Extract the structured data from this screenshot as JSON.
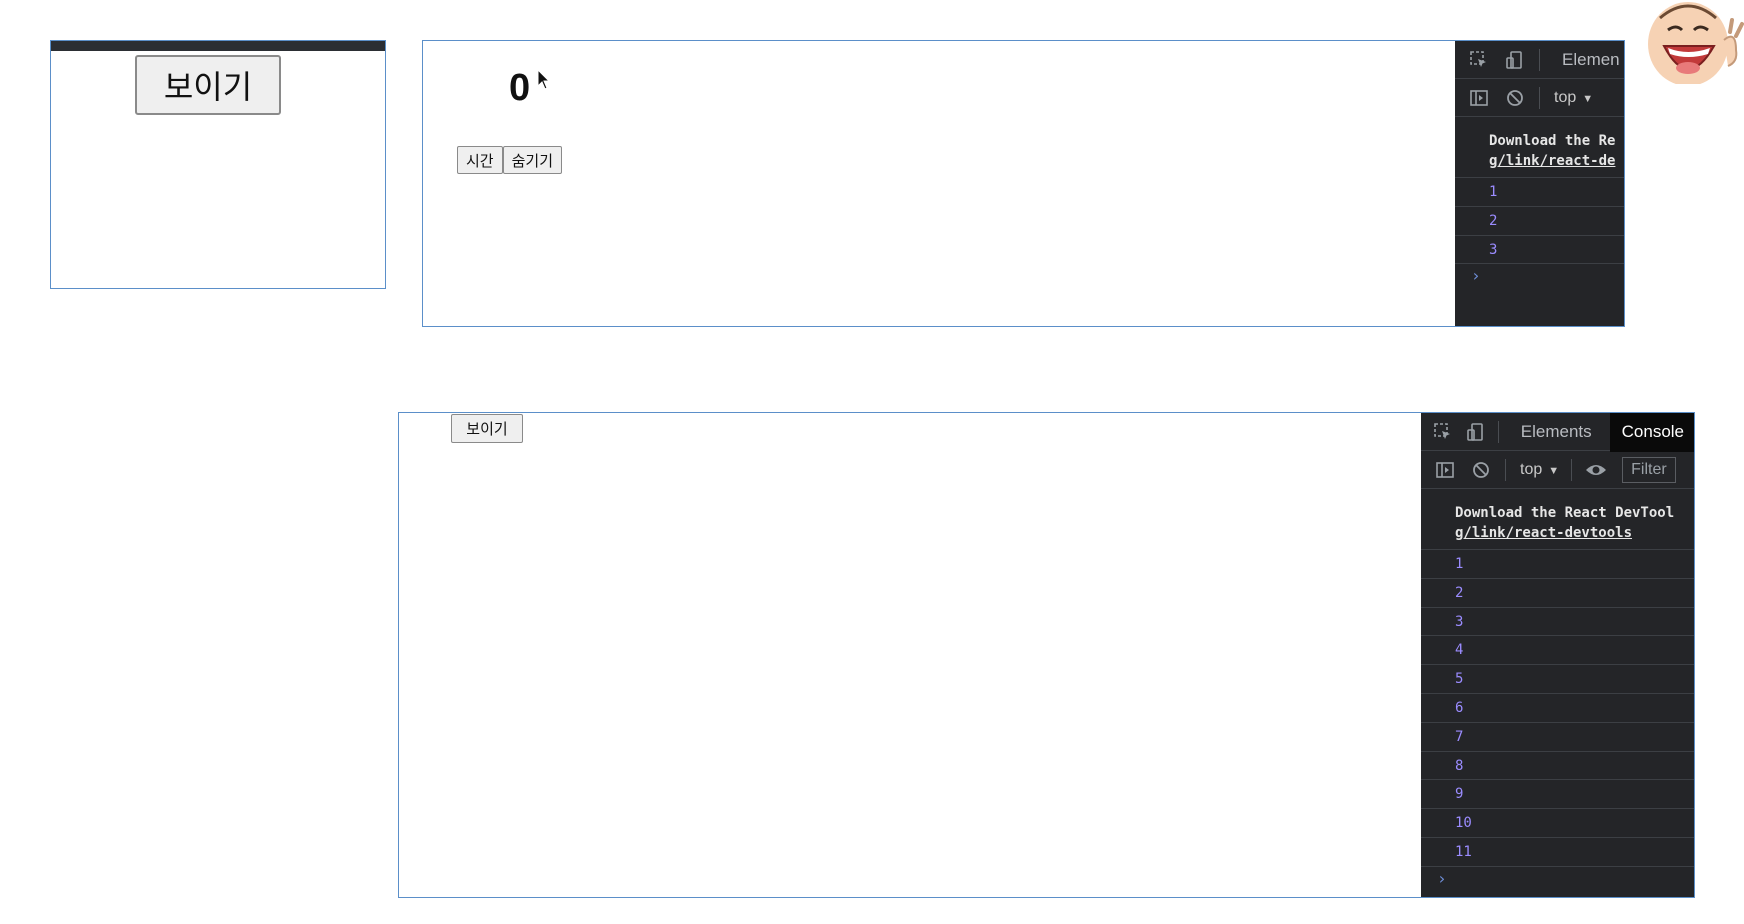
{
  "panel1": {
    "button_label": "보이기"
  },
  "panel2": {
    "counter": "0",
    "buttons": [
      "시간",
      "숨기기"
    ],
    "devtools": {
      "tabs": [
        "Elemen"
      ],
      "context": "top",
      "message_line1": "Download the Re",
      "message_link": "g/link/react-de",
      "logs": [
        "1",
        "2",
        "3"
      ],
      "prompt": "›"
    }
  },
  "panel3": {
    "button_label": "보이기",
    "devtools": {
      "tabs": [
        "Elements",
        "Console"
      ],
      "context": "top",
      "filter_placeholder": "Filter",
      "message_line1": "Download the React DevTool",
      "message_link": "g/link/react-devtools",
      "logs": [
        "1",
        "2",
        "3",
        "4",
        "5",
        "6",
        "7",
        "8",
        "9",
        "10",
        "11"
      ],
      "prompt": "›"
    }
  },
  "colors": {
    "frame_border": "#5b8fc9",
    "devtools_bg": "#242528",
    "log_number": "#9b8cff"
  },
  "icons": [
    "inspect-icon",
    "device-toggle-icon",
    "sidebar-toggle-icon",
    "clear-console-icon",
    "eye-icon",
    "mouse-cursor-icon",
    "cartoon-avatar"
  ]
}
